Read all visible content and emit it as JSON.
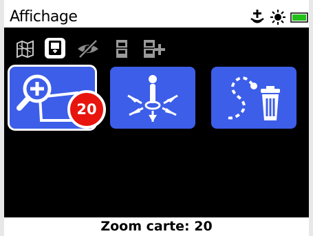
{
  "window": {
    "title": "Affichage"
  },
  "status": {
    "icons": [
      "metal-detector-signal-icon",
      "sun-brightness-icon",
      "battery-icon"
    ],
    "battery_color": "#22c01a"
  },
  "toolbar": {
    "icons": [
      "map-icon",
      "detector-device-icon",
      "hidden-eye-icon",
      "data-storage-icon",
      "add-storage-icon"
    ]
  },
  "tiles": [
    {
      "name": "zoom-map-tile",
      "icon": "zoom-in-map-icon",
      "badge": "20",
      "selected": true
    },
    {
      "name": "center-position-tile",
      "icon": "person-center-arrows-icon"
    },
    {
      "name": "clear-trail-tile",
      "icon": "trail-delete-icon"
    }
  ],
  "footer": {
    "label": "Zoom carte: 20"
  },
  "colors": {
    "accent": "#3d5ee8",
    "badge": "#e8150f",
    "background": "#000000"
  }
}
